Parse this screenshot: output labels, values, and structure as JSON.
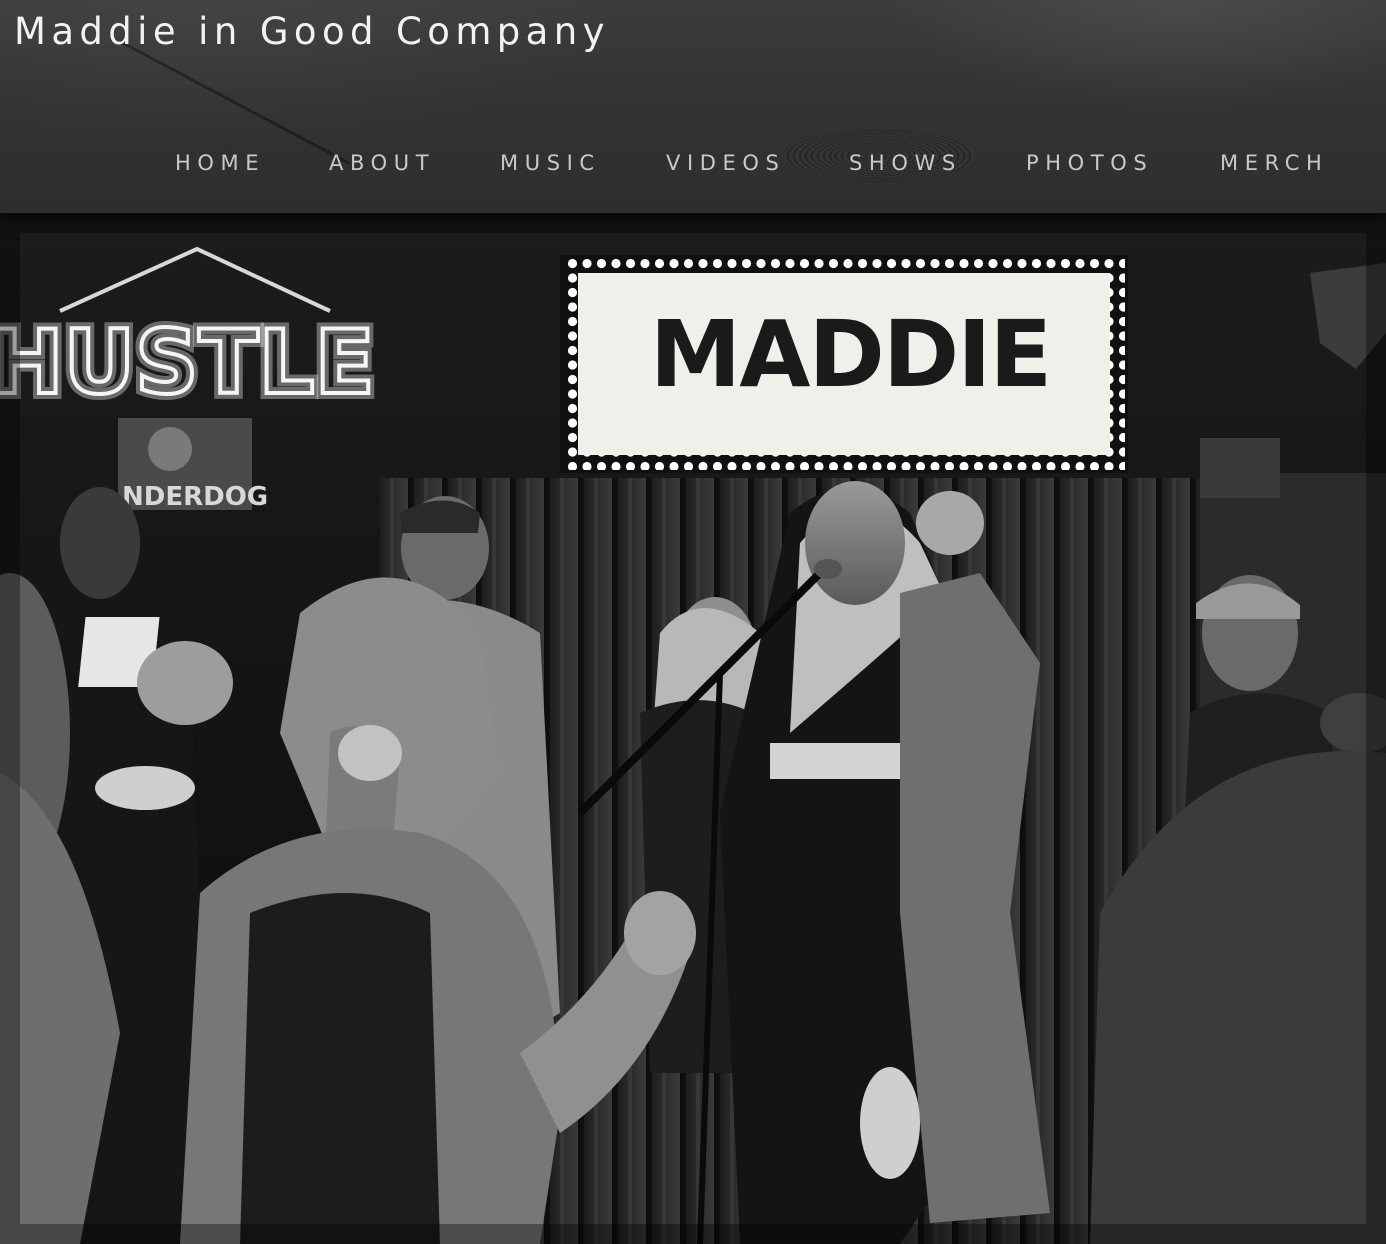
{
  "site": {
    "title": "Maddie in Good Company"
  },
  "nav": {
    "items": [
      {
        "label": "HOME"
      },
      {
        "label": "ABOUT"
      },
      {
        "label": "MUSIC"
      },
      {
        "label": "VIDEOS"
      },
      {
        "label": "SHOWS"
      },
      {
        "label": "PHOTOS"
      },
      {
        "label": "MERCH"
      }
    ]
  },
  "hero": {
    "marquee_text": "MADDIE",
    "neon_sign_text": "HUSTLE",
    "poster_text": "NDERDOG"
  },
  "colors": {
    "header_bg": "#333335",
    "title_text": "#f2f2f2",
    "nav_text": "#c9c9cb"
  }
}
